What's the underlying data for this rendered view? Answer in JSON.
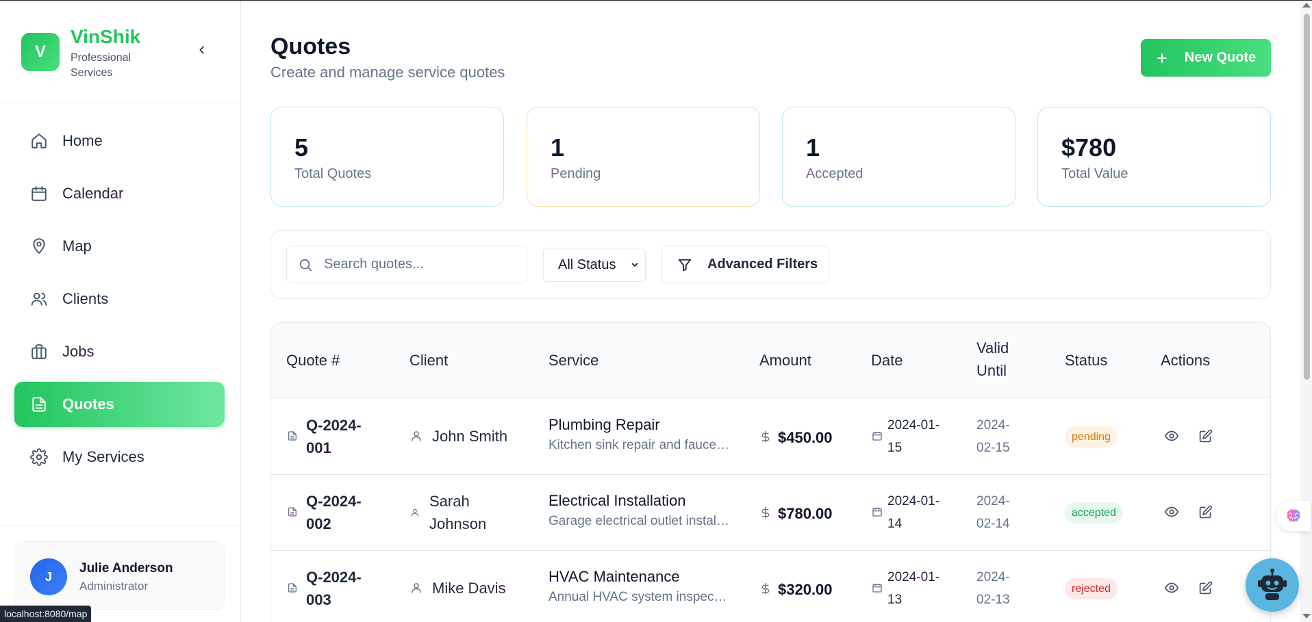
{
  "brand": {
    "initial": "V",
    "name": "VinShik",
    "tagline": "Professional Services"
  },
  "nav": [
    {
      "label": "Home",
      "icon": "home-icon"
    },
    {
      "label": "Calendar",
      "icon": "calendar-icon"
    },
    {
      "label": "Map",
      "icon": "map-pin-icon"
    },
    {
      "label": "Clients",
      "icon": "users-icon"
    },
    {
      "label": "Jobs",
      "icon": "briefcase-icon"
    },
    {
      "label": "Quotes",
      "icon": "document-icon",
      "active": true
    },
    {
      "label": "My Services",
      "icon": "gear-icon"
    }
  ],
  "user": {
    "initial": "J",
    "name": "Julie Anderson",
    "role": "Administrator"
  },
  "status_url": "localhost:8080/map",
  "header": {
    "title": "Quotes",
    "subtitle": "Create and manage service quotes",
    "new_button": "New Quote"
  },
  "stats": [
    {
      "value": "5",
      "label": "Total Quotes",
      "border": "#bbf0d4"
    },
    {
      "value": "1",
      "label": "Pending",
      "border": "#fcd9a4"
    },
    {
      "value": "1",
      "label": "Accepted",
      "border": "#bbf0d4"
    },
    {
      "value": "$780",
      "label": "Total Value",
      "border": "#bfdbfe"
    }
  ],
  "filters": {
    "search_placeholder": "Search quotes...",
    "status_value": "All Status",
    "advanced_label": "Advanced Filters"
  },
  "table": {
    "headers": [
      "Quote #",
      "Client",
      "Service",
      "Amount",
      "Date",
      "Valid Until",
      "Status",
      "Actions"
    ],
    "rows": [
      {
        "quote": "Q-2024-001",
        "client": "John Smith",
        "service": "Plumbing Repair",
        "description": "Kitchen sink repair and faucet replacement",
        "amount": "$450.00",
        "date": "2024-01-15",
        "valid_until": "2024-02-15",
        "status": "pending"
      },
      {
        "quote": "Q-2024-002",
        "client": "Sarah Johnson",
        "service": "Electrical Installation",
        "description": "Garage electrical outlet installation",
        "amount": "$780.00",
        "date": "2024-01-14",
        "valid_until": "2024-02-14",
        "status": "accepted"
      },
      {
        "quote": "Q-2024-003",
        "client": "Mike Davis",
        "service": "HVAC Maintenance",
        "description": "Annual HVAC system inspection",
        "amount": "$320.00",
        "date": "2024-01-13",
        "valid_until": "2024-02-13",
        "status": "rejected"
      }
    ]
  }
}
